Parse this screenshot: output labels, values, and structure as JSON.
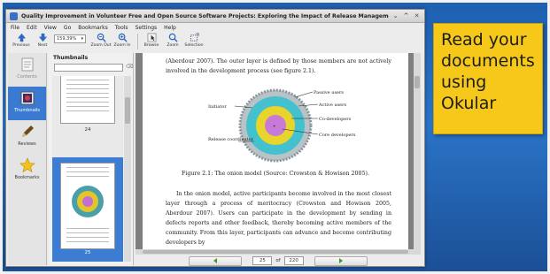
{
  "window": {
    "title": "Quality Improvement in Volunteer Free and Open Source Software Projects: Exploring the Impact of Release Management – Okular"
  },
  "menubar": [
    "File",
    "Edit",
    "View",
    "Go",
    "Bookmarks",
    "Tools",
    "Settings",
    "Help"
  ],
  "toolbar": {
    "previous": "Previous",
    "next": "Next",
    "zoom_value": "159.39%",
    "zoom_out": "Zoom Out",
    "zoom_in": "Zoom In",
    "browse": "Browse",
    "zoom": "Zoom",
    "selection": "Selection"
  },
  "sidebar": {
    "contents": "Contents",
    "thumbnails": "Thumbnails",
    "reviews": "Reviews",
    "bookmarks": "Bookmarks"
  },
  "thumbnails": {
    "title": "Thumbnails",
    "page_above": "24",
    "page_selected": "25"
  },
  "document": {
    "para_top": "(Aberdour 2007). The outer layer is defined by those members are not actively involved in the development process (see figure 2.1).",
    "diagram_labels": {
      "passive": "Passive users",
      "active": "Active users",
      "codev": "Co-developers",
      "core": "Core developers",
      "initiator": "Initiator",
      "release": "Release coordinator"
    },
    "caption": "Figure 2.1: The onion model (Source: Crowston & Howison 2005).",
    "para_bottom": "In the onion model, active participants become involved in the most closest layer through a process of meritocracy (Crowston and Howison 2005, Aberdour 2007). Users can participate in the development by sending in defects reports and other feedback, thereby becoming active members of the community. From this layer, participants can advance and become contributing developers by"
  },
  "nav": {
    "current_page": "25",
    "of": "of",
    "total_pages": "220"
  },
  "overlay": {
    "line1": "Read your",
    "line2": "documents",
    "line3": "using",
    "line4": "Okular"
  }
}
